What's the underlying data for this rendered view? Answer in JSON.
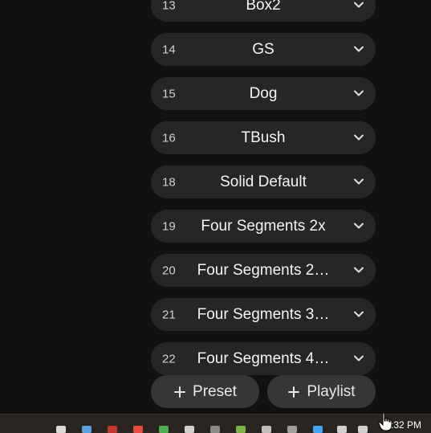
{
  "presets": [
    {
      "num": "13",
      "name": "Box2"
    },
    {
      "num": "14",
      "name": "GS"
    },
    {
      "num": "15",
      "name": "Dog"
    },
    {
      "num": "16",
      "name": "TBush"
    },
    {
      "num": "18",
      "name": "Solid Default"
    },
    {
      "num": "19",
      "name": "Four Segments 2x"
    },
    {
      "num": "20",
      "name": "Four Segments 2…"
    },
    {
      "num": "21",
      "name": "Four Segments 3…"
    },
    {
      "num": "22",
      "name": "Four Segments 4…"
    }
  ],
  "buttons": {
    "add_preset_label": "Preset",
    "add_playlist_label": "Playlist"
  },
  "taskbar": {
    "clock": ":32 PM",
    "icon_colors": [
      "#d9d9d9",
      "#5aa0e0",
      "#c0392b",
      "#e84c3d",
      "#4caf50",
      "#cfcfcf",
      "#8a8a8a",
      "#7cb342",
      "#bdbdbd",
      "#9e9e9e",
      "#42a5f5",
      "#cfcfcf",
      "#cfcfcf"
    ]
  },
  "colors": {
    "background": "#111111",
    "item_bg": "#262626",
    "button_bg": "#363636"
  }
}
